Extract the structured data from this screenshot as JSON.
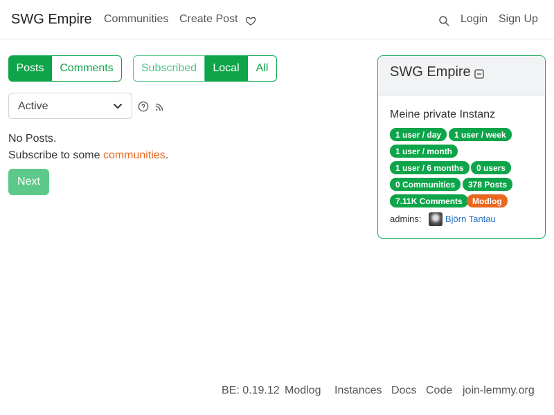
{
  "navbar": {
    "brand": "SWG Empire",
    "communities": "Communities",
    "create_post": "Create Post",
    "donate_icon": "heart-icon",
    "search_icon": "search-icon",
    "login": "Login",
    "signup": "Sign Up"
  },
  "listing_type": {
    "posts": "Posts",
    "comments": "Comments",
    "active_view": "Posts"
  },
  "scope": {
    "subscribed": "Subscribed",
    "local": "Local",
    "all": "All",
    "active_scope": "Local"
  },
  "sort": {
    "selected": "Active",
    "help_icon": "question-circle-icon",
    "rss_icon": "rss-icon"
  },
  "main": {
    "no_posts": "No Posts.",
    "subscribe_prefix": "Subscribe to some ",
    "subscribe_link": "communities",
    "subscribe_suffix": ".",
    "next": "Next"
  },
  "sidebar": {
    "title": "SWG Empire",
    "collapse_icon": "minus-square-icon",
    "description": "Meine private Instanz",
    "badges": [
      "1 user / day",
      "1 user / week",
      "1 user / month",
      "1 user / 6 months",
      "0 users",
      "0 Communities",
      "378 Posts",
      "7.11K Comments",
      "Modlog"
    ],
    "admins_label": "admins:",
    "admin_name": "Björn Tantau"
  },
  "footer": {
    "version": "BE: 0.19.12",
    "modlog": "Modlog",
    "instances": "Instances",
    "docs": "Docs",
    "code": "Code",
    "join": "join-lemmy.org"
  },
  "colors": {
    "primary": "#0ea54a",
    "accent": "#e8681f",
    "link": "#2a72c9"
  }
}
